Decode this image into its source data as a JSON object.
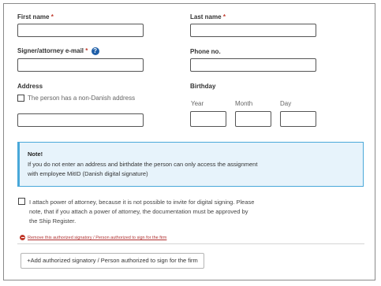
{
  "form": {
    "first_name": {
      "label": "First name",
      "required_mark": "*",
      "value": ""
    },
    "last_name": {
      "label": "Last name",
      "required_mark": "*",
      "value": ""
    },
    "email": {
      "label": "Signer/attorney e-mail",
      "required_mark": "*",
      "info_icon": "?",
      "value": ""
    },
    "phone": {
      "label": "Phone no.",
      "value": ""
    },
    "address": {
      "label": "Address",
      "non_danish_checkbox_label": "The person has a non-Danish address",
      "non_danish_checked": false,
      "value": ""
    },
    "birthday": {
      "label": "Birthday",
      "year_label": "Year",
      "month_label": "Month",
      "day_label": "Day",
      "year": "",
      "month": "",
      "day": ""
    }
  },
  "note": {
    "title": "Note!",
    "text": "If you do not enter an address and birthdate the person can only access the assignment with employee MitID (Danish digital signature)",
    "accent_color": "#49a8d9"
  },
  "power_of_attorney": {
    "checked": false,
    "text": "I attach power of attorney, because it is not possible to invite for digital signing. Please note, that if you attach a power of attorney, the documentation must be approved by the Ship Register."
  },
  "remove_link": {
    "icon": "minus-circle-icon",
    "text": "Remove this authorized signatory / Person authorized to sign for the firm",
    "color": "#b03030"
  },
  "add_button": {
    "label": "+Add authorized signatory / Person authorized to sign for the firm"
  }
}
